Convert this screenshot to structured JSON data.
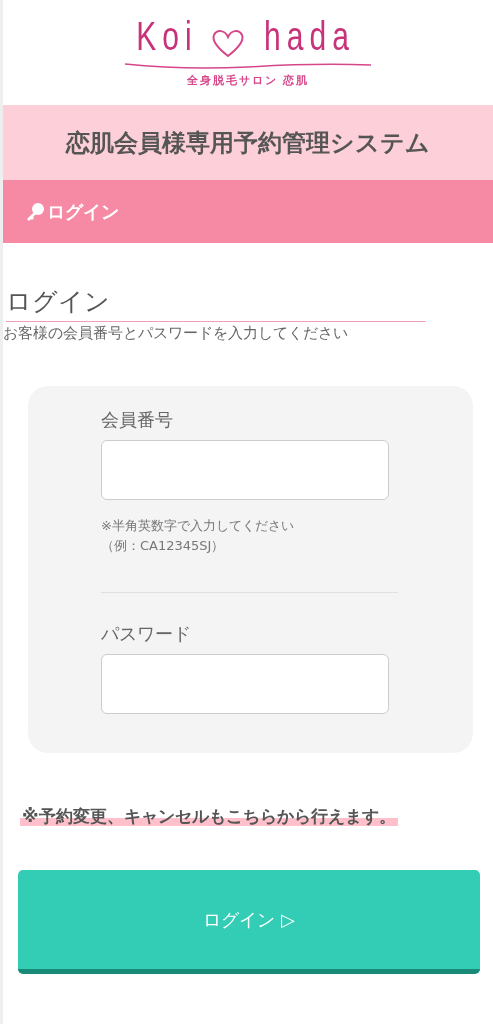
{
  "logo": {
    "word_left": "Koi",
    "word_right": "hada",
    "tagline": "全身脱毛サロン 恋肌"
  },
  "system_title": "恋肌会員様専用予約管理システム",
  "breadcrumb": "ログイン",
  "heading": "ログイン",
  "description": "お客様の会員番号とパスワードを入力してください",
  "form": {
    "fields": [
      {
        "label": "会員番号",
        "hint_lines": [
          "※半角英数字で入力してください",
          "（例：CA12345SJ）"
        ]
      },
      {
        "label": "パスワード"
      }
    ]
  },
  "notice": "※予約変更、キャンセルもこちらから行えます。",
  "submit_button": "ログイン ▷"
}
